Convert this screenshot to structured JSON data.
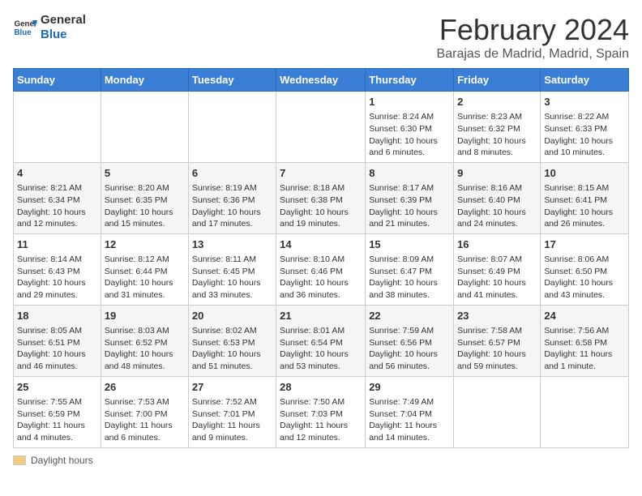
{
  "header": {
    "logo_general": "General",
    "logo_blue": "Blue",
    "month_title": "February 2024",
    "location": "Barajas de Madrid, Madrid, Spain"
  },
  "days_of_week": [
    "Sunday",
    "Monday",
    "Tuesday",
    "Wednesday",
    "Thursday",
    "Friday",
    "Saturday"
  ],
  "weeks": [
    [
      {
        "day": "",
        "info": ""
      },
      {
        "day": "",
        "info": ""
      },
      {
        "day": "",
        "info": ""
      },
      {
        "day": "",
        "info": ""
      },
      {
        "day": "1",
        "info": "Sunrise: 8:24 AM\nSunset: 6:30 PM\nDaylight: 10 hours and 6 minutes."
      },
      {
        "day": "2",
        "info": "Sunrise: 8:23 AM\nSunset: 6:32 PM\nDaylight: 10 hours and 8 minutes."
      },
      {
        "day": "3",
        "info": "Sunrise: 8:22 AM\nSunset: 6:33 PM\nDaylight: 10 hours and 10 minutes."
      }
    ],
    [
      {
        "day": "4",
        "info": "Sunrise: 8:21 AM\nSunset: 6:34 PM\nDaylight: 10 hours and 12 minutes."
      },
      {
        "day": "5",
        "info": "Sunrise: 8:20 AM\nSunset: 6:35 PM\nDaylight: 10 hours and 15 minutes."
      },
      {
        "day": "6",
        "info": "Sunrise: 8:19 AM\nSunset: 6:36 PM\nDaylight: 10 hours and 17 minutes."
      },
      {
        "day": "7",
        "info": "Sunrise: 8:18 AM\nSunset: 6:38 PM\nDaylight: 10 hours and 19 minutes."
      },
      {
        "day": "8",
        "info": "Sunrise: 8:17 AM\nSunset: 6:39 PM\nDaylight: 10 hours and 21 minutes."
      },
      {
        "day": "9",
        "info": "Sunrise: 8:16 AM\nSunset: 6:40 PM\nDaylight: 10 hours and 24 minutes."
      },
      {
        "day": "10",
        "info": "Sunrise: 8:15 AM\nSunset: 6:41 PM\nDaylight: 10 hours and 26 minutes."
      }
    ],
    [
      {
        "day": "11",
        "info": "Sunrise: 8:14 AM\nSunset: 6:43 PM\nDaylight: 10 hours and 29 minutes."
      },
      {
        "day": "12",
        "info": "Sunrise: 8:12 AM\nSunset: 6:44 PM\nDaylight: 10 hours and 31 minutes."
      },
      {
        "day": "13",
        "info": "Sunrise: 8:11 AM\nSunset: 6:45 PM\nDaylight: 10 hours and 33 minutes."
      },
      {
        "day": "14",
        "info": "Sunrise: 8:10 AM\nSunset: 6:46 PM\nDaylight: 10 hours and 36 minutes."
      },
      {
        "day": "15",
        "info": "Sunrise: 8:09 AM\nSunset: 6:47 PM\nDaylight: 10 hours and 38 minutes."
      },
      {
        "day": "16",
        "info": "Sunrise: 8:07 AM\nSunset: 6:49 PM\nDaylight: 10 hours and 41 minutes."
      },
      {
        "day": "17",
        "info": "Sunrise: 8:06 AM\nSunset: 6:50 PM\nDaylight: 10 hours and 43 minutes."
      }
    ],
    [
      {
        "day": "18",
        "info": "Sunrise: 8:05 AM\nSunset: 6:51 PM\nDaylight: 10 hours and 46 minutes."
      },
      {
        "day": "19",
        "info": "Sunrise: 8:03 AM\nSunset: 6:52 PM\nDaylight: 10 hours and 48 minutes."
      },
      {
        "day": "20",
        "info": "Sunrise: 8:02 AM\nSunset: 6:53 PM\nDaylight: 10 hours and 51 minutes."
      },
      {
        "day": "21",
        "info": "Sunrise: 8:01 AM\nSunset: 6:54 PM\nDaylight: 10 hours and 53 minutes."
      },
      {
        "day": "22",
        "info": "Sunrise: 7:59 AM\nSunset: 6:56 PM\nDaylight: 10 hours and 56 minutes."
      },
      {
        "day": "23",
        "info": "Sunrise: 7:58 AM\nSunset: 6:57 PM\nDaylight: 10 hours and 59 minutes."
      },
      {
        "day": "24",
        "info": "Sunrise: 7:56 AM\nSunset: 6:58 PM\nDaylight: 11 hours and 1 minute."
      }
    ],
    [
      {
        "day": "25",
        "info": "Sunrise: 7:55 AM\nSunset: 6:59 PM\nDaylight: 11 hours and 4 minutes."
      },
      {
        "day": "26",
        "info": "Sunrise: 7:53 AM\nSunset: 7:00 PM\nDaylight: 11 hours and 6 minutes."
      },
      {
        "day": "27",
        "info": "Sunrise: 7:52 AM\nSunset: 7:01 PM\nDaylight: 11 hours and 9 minutes."
      },
      {
        "day": "28",
        "info": "Sunrise: 7:50 AM\nSunset: 7:03 PM\nDaylight: 11 hours and 12 minutes."
      },
      {
        "day": "29",
        "info": "Sunrise: 7:49 AM\nSunset: 7:04 PM\nDaylight: 11 hours and 14 minutes."
      },
      {
        "day": "",
        "info": ""
      },
      {
        "day": "",
        "info": ""
      }
    ]
  ],
  "legend": {
    "label": "Daylight hours"
  }
}
